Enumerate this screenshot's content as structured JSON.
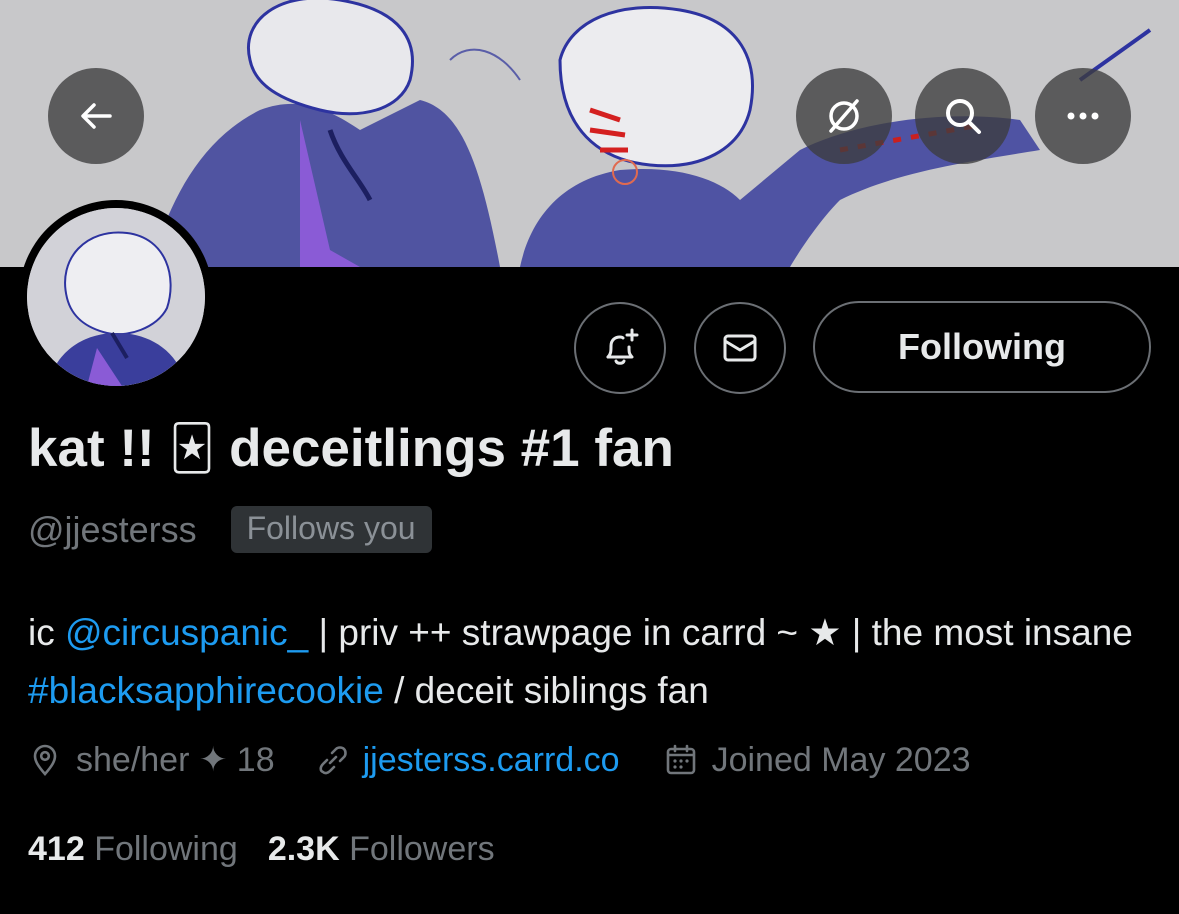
{
  "header": {
    "back_icon": "arrow-left-icon",
    "grok_icon": "slashed-circle-icon",
    "search_icon": "search-icon",
    "more_icon": "more-horizontal-icon"
  },
  "actions": {
    "notify_icon": "bell-plus-icon",
    "message_icon": "envelope-icon",
    "follow_label": "Following"
  },
  "profile": {
    "name_part1": "kat !! ",
    "name_emoji": "🃏",
    "name_part2": " deceitlings #1 fan",
    "handle": "@jjesterss",
    "follows_you": "Follows you"
  },
  "bio": {
    "t1": "ic ",
    "mention": "@circuspanic_",
    "t2": " | priv ++ strawpage in carrd ~ ★ | the most insane ",
    "hashtag": "#blacksapphirecookie",
    "t3": " / deceit siblings fan"
  },
  "meta": {
    "location": "she/her ✦ 18",
    "website": "jjesterss.carrd.co",
    "joined": "Joined May 2023"
  },
  "stats": {
    "following_count": "412",
    "following_label": "Following",
    "followers_count": "2.3K",
    "followers_label": "Followers"
  },
  "colors": {
    "background": "#000000",
    "link": "#1d9bf0",
    "muted": "#71767b",
    "text": "#e7e9ea"
  }
}
